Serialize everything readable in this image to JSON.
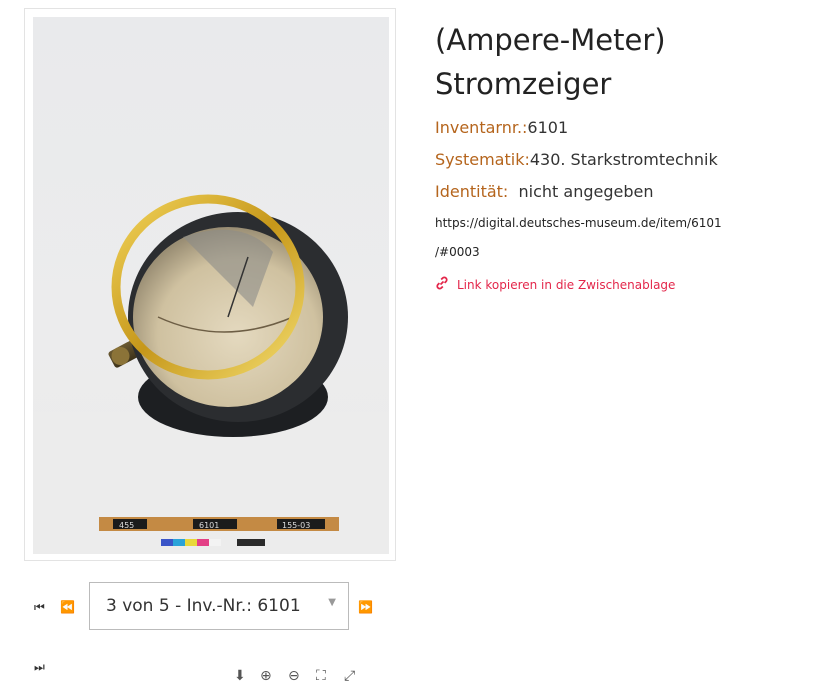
{
  "object": {
    "title_line1": "(Ampere-Meter)",
    "title_line2": "Stromzeiger",
    "inventarnr_label": "Inventarnr.:",
    "inventarnr_value": "6101",
    "systematik_label": "Systematik:",
    "systematik_value": "430. Starkstromtechnik",
    "identitaet_label": "Identität:",
    "identitaet_value": "nicht angegeben",
    "url_line1": "https://digital.deutsches-museum.de/item/6101",
    "url_line2": "/#0003",
    "copy_link_label": "Link kopieren in die Zwischenablage"
  },
  "photo": {
    "scale_labels": [
      "455",
      "6101",
      "155-03"
    ]
  },
  "navigation": {
    "selected_option": "3 von 5 - Inv.-Nr.: 6101"
  },
  "colors": {
    "label": "#b5651d",
    "link": "#e3264a"
  }
}
